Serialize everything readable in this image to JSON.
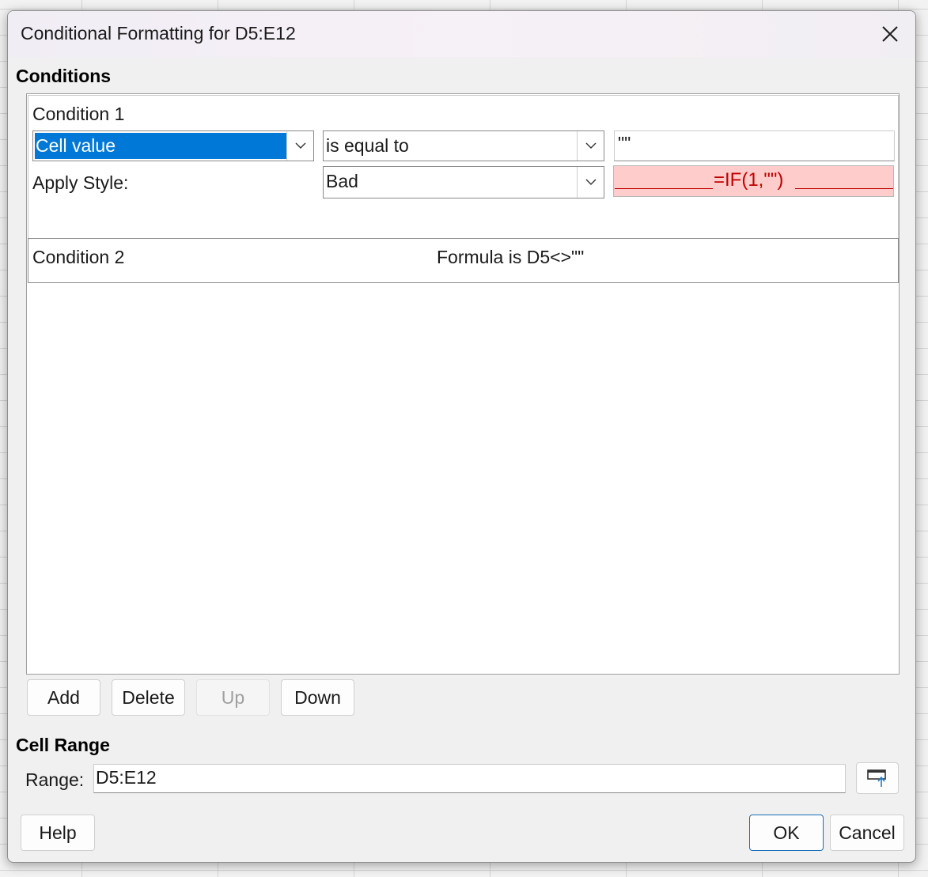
{
  "dialog": {
    "title": "Conditional Formatting for D5:E12",
    "close_icon": "close-icon"
  },
  "conditions": {
    "section_label": "Conditions",
    "condition1": {
      "header": "Condition 1",
      "type_value": "Cell value",
      "operator_value": "is equal to",
      "value_input": "\"\"",
      "apply_style_label": "Apply Style:",
      "style_value": "Bad",
      "preview_text": "=IF(1,\"\")"
    },
    "condition2": {
      "header": "Condition 2",
      "summary": "Formula is  D5<>\"\""
    }
  },
  "list_buttons": {
    "add": "Add",
    "delete": "Delete",
    "up": "Up",
    "down": "Down"
  },
  "cell_range": {
    "section_label": "Cell Range",
    "range_label": "Range:",
    "range_value": "D5:E12",
    "shrink_icon": "shrink-dialog-icon"
  },
  "footer": {
    "help": "Help",
    "ok": "OK",
    "cancel": "Cancel"
  },
  "colors": {
    "selection": "#0078d7",
    "bad_style_bg": "#ffcccc",
    "bad_style_text": "#c00000",
    "ok_border": "#1a6fb8"
  }
}
